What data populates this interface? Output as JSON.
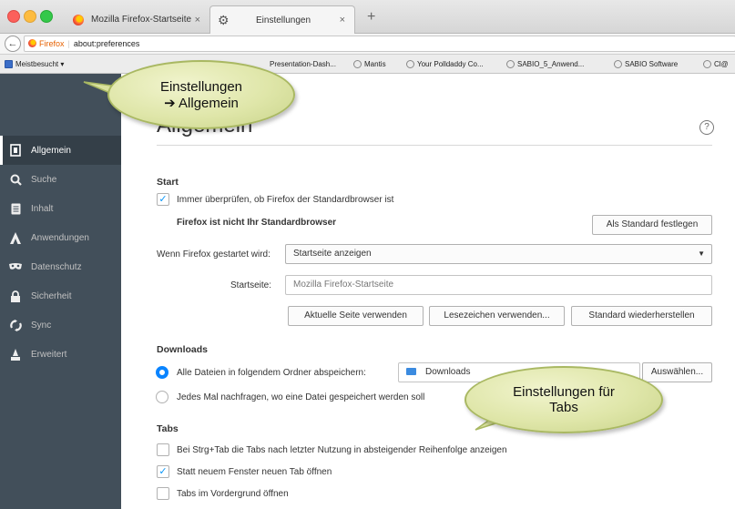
{
  "tabs": [
    {
      "title": "Mozilla Firefox-Startseite",
      "close": "×"
    },
    {
      "title": "Einstellungen",
      "close": "×"
    }
  ],
  "new_tab": "+",
  "nav": {
    "back": "←",
    "identity": "Firefox",
    "url": "about:preferences"
  },
  "bookmarks": [
    "Meistbesucht ▾",
    "Presentation-Dash...",
    "Mantis",
    "Your Polldaddy Co...",
    "SABIO_5_Anwend...",
    "SABIO Software",
    "Cl@"
  ],
  "sidebar": {
    "items": [
      {
        "label": "Allgemein",
        "icon": "general-icon"
      },
      {
        "label": "Suche",
        "icon": "search-icon"
      },
      {
        "label": "Inhalt",
        "icon": "content-icon"
      },
      {
        "label": "Anwendungen",
        "icon": "applications-icon"
      },
      {
        "label": "Datenschutz",
        "icon": "privacy-mask-icon"
      },
      {
        "label": "Sicherheit",
        "icon": "lock-icon"
      },
      {
        "label": "Sync",
        "icon": "sync-icon"
      },
      {
        "label": "Erweitert",
        "icon": "advanced-icon"
      }
    ]
  },
  "page": {
    "title": "Allgemein",
    "help": "?"
  },
  "start": {
    "heading": "Start",
    "check_default": "Immer überprüfen, ob Firefox der Standardbrowser ist",
    "check_default_checked": true,
    "not_default": "Firefox ist nicht Ihr Standardbrowser",
    "make_default_btn": "Als Standard festlegen",
    "startup_label": "Wenn Firefox gestartet wird:",
    "startup_value": "Startseite anzeigen",
    "homepage_label": "Startseite:",
    "homepage_placeholder": "Mozilla Firefox-Startseite",
    "btn_current": "Aktuelle Seite verwenden",
    "btn_bookmark": "Lesezeichen verwenden...",
    "btn_restore": "Standard wiederherstellen"
  },
  "downloads": {
    "heading": "Downloads",
    "radio_save": "Alle Dateien in folgendem Ordner abspeichern:",
    "folder": "Downloads",
    "choose_btn": "Auswählen...",
    "radio_ask": "Jedes Mal nachfragen, wo eine Datei gespeichert werden soll"
  },
  "tabs_section": {
    "heading": "Tabs",
    "opt1": "Bei Strg+Tab die Tabs nach letzter Nutzung in absteigender Reihenfolge anzeigen",
    "opt1_checked": false,
    "opt2": "Statt neuem Fenster neuen Tab öffnen",
    "opt2_checked": true,
    "opt3": "Tabs im Vordergrund öffnen",
    "opt3_checked": false
  },
  "callouts": {
    "top_line1": "Einstellungen",
    "top_line2": "➔ Allgemein",
    "bottom_line1": "Einstellungen für",
    "bottom_line2": "Tabs"
  },
  "colors": {
    "sidebar": "#424f5a",
    "sidebar_active": "#343f48",
    "accent": "#0a84ff",
    "callout": "#dfe6a9"
  }
}
